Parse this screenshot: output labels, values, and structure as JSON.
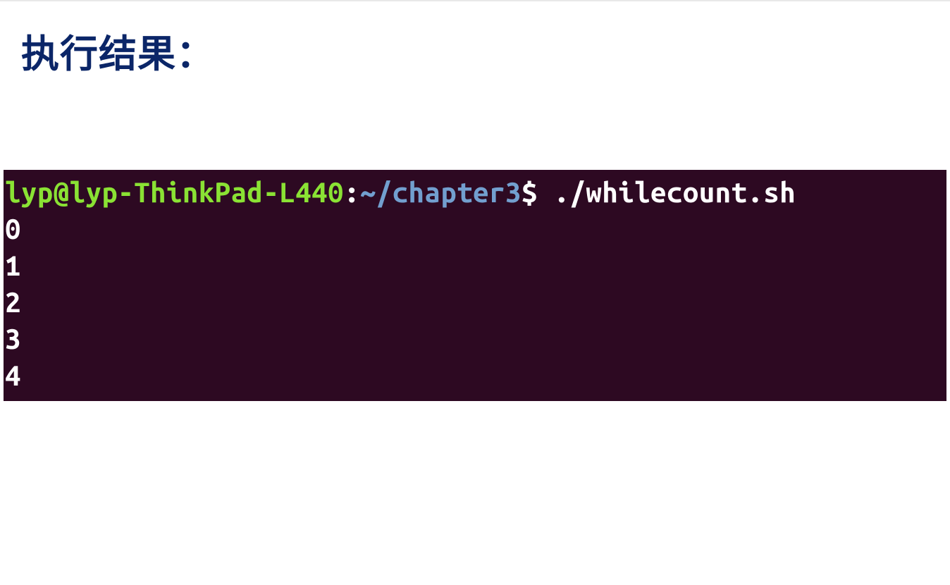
{
  "title": "执行结果：",
  "terminal": {
    "user": "lyp",
    "host": "lyp-ThinkPad-L440",
    "separator_at": "@",
    "colon": ":",
    "path": "~/chapter3",
    "dollar": "$",
    "command": " ./whilecount.sh",
    "output": [
      "0",
      "1",
      "2",
      "3",
      "4"
    ]
  }
}
